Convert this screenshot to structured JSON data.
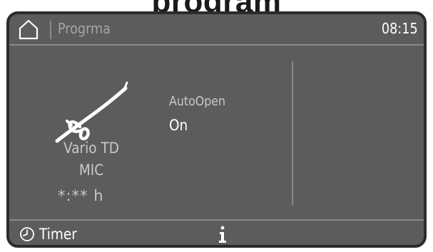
{
  "page": {
    "cut_title": "program"
  },
  "display": {
    "topbar": {
      "home_icon": "home-icon",
      "title": "Progrma",
      "time": "08:15"
    },
    "program": {
      "symbol_icon": "vario-td-instrument-icon",
      "name_line1": "Vario TD",
      "name_line2": "MIC",
      "duration": "*:** h"
    },
    "option": {
      "label": "AutoOpen",
      "value": "On"
    },
    "bottombar": {
      "timer_icon": "clock-icon",
      "timer_label": "Timer",
      "info_icon": "info-icon"
    }
  },
  "colors": {
    "screen_bg": "#5c5c5c",
    "bezel": "#2b2b2b",
    "divider": "#8a8a8a",
    "text_primary": "#ffffff",
    "text_secondary": "#c8c8c8"
  }
}
